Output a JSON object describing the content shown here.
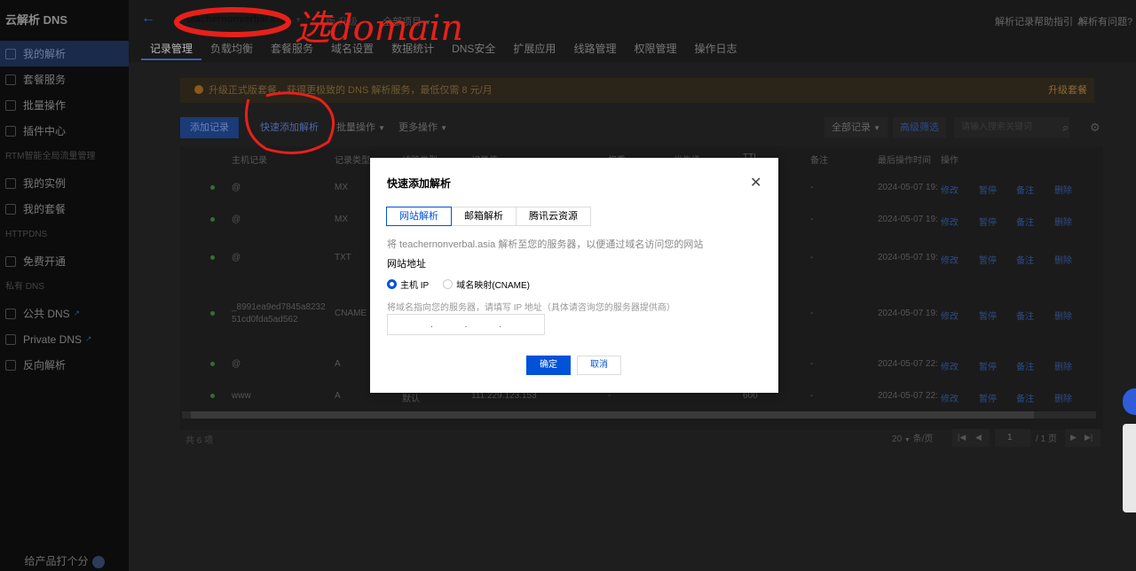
{
  "sidebar": {
    "title": "云解析 DNS",
    "items_main": [
      {
        "label": "我的解析",
        "active": true
      },
      {
        "label": "套餐服务"
      },
      {
        "label": "批量操作"
      },
      {
        "label": "插件中心"
      }
    ],
    "section1": "RTM智能全局流量管理",
    "items_rtm": [
      {
        "label": "我的实例"
      },
      {
        "label": "我的套餐"
      }
    ],
    "section2": "HTTPDNS",
    "items_http": [
      {
        "label": "免费开通"
      }
    ],
    "section3": "私有 DNS",
    "items_private": [
      {
        "label": "公共 DNS"
      },
      {
        "label": "Private DNS"
      },
      {
        "label": "反向解析"
      }
    ],
    "footer": "给产品打个分"
  },
  "header": {
    "domain": "teachernonverbal.asia",
    "version_prefix": "版",
    "upgrade": "升级",
    "project": "全部项目",
    "help_guide": "解析记录帮助指引",
    "help_question": "解析有问题?",
    "tabs": [
      "记录管理",
      "负载均衡",
      "套餐服务",
      "域名设置",
      "数据统计",
      "DNS安全",
      "扩展应用",
      "线路管理",
      "权限管理",
      "操作日志"
    ]
  },
  "notice": {
    "text": "升级正式版套餐，获得更极致的 DNS 解析服务，最低仅需 8 元/月",
    "action": "升级套餐"
  },
  "toolbar": {
    "add": "添加记录",
    "quick_add": "快速添加解析",
    "batch": "批量操作",
    "more": "更多操作",
    "all_records": "全部记录",
    "advanced": "高级筛选",
    "search_placeholder": "请输入搜索关键词"
  },
  "table": {
    "headers": [
      "主机记录",
      "记录类型",
      "线路类型",
      "记录值",
      "权重",
      "优先级",
      "TTL",
      "备注",
      "最后操作时间",
      "操作"
    ],
    "rows": [
      {
        "host": "@",
        "type": "MX",
        "remark": "-",
        "time": "2024-05-07 19:"
      },
      {
        "host": "@",
        "type": "MX",
        "remark": "-",
        "time": "2024-05-07 19:"
      },
      {
        "host": "@",
        "type": "TXT",
        "remark": "-",
        "time": "2024-05-07 19:"
      },
      {
        "host": "_8991ea9ed7845a8232",
        "host2": "51cd0fda5ad562",
        "type": "CNAME",
        "remark": "-",
        "time": "2024-05-07 19:"
      },
      {
        "host": "@",
        "type": "A",
        "remark": "-",
        "time": "2024-05-07 22:"
      },
      {
        "host": "www",
        "type": "A",
        "line": "默认",
        "value": "111.229.123.153",
        "weight": "-",
        "ttl": "600",
        "remark": "-",
        "time": "2024-05-07 22:"
      }
    ],
    "actions": [
      "修改",
      "暂停",
      "备注",
      "删除"
    ]
  },
  "pagination": {
    "total": "共 6 项",
    "page_size": "20",
    "page_size_unit": "条/页",
    "current": "1",
    "pages": "/ 1 页"
  },
  "annotations": {
    "text": "选domain"
  },
  "dialog": {
    "title": "快速添加解析",
    "tabs": [
      "网站解析",
      "邮箱解析",
      "腾讯云资源"
    ],
    "description": "将 teachernonverbal.asia 解析至您的服务器，以便通过域名访问您的网站",
    "label": "网站地址",
    "radio_ip": "主机 IP",
    "radio_cname": "域名映射(CNAME)",
    "hint": "将域名指向您的服务器，请填写 IP 地址（具体请咨询您的服务器提供商）",
    "ok": "确定",
    "cancel": "取消"
  },
  "colors": {
    "primary": "#0052d9",
    "annotation": "#e8201a"
  }
}
